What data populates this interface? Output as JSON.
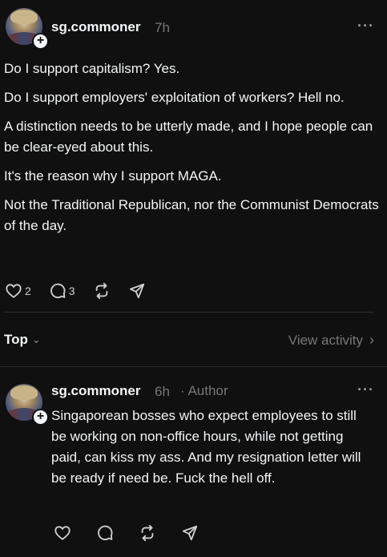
{
  "post": {
    "username": "sg.commoner",
    "time": "7h",
    "paragraphs": [
      "Do I support capitalism? Yes.",
      "Do I support employers' exploitation of workers? Hell no.",
      "A distinction needs to be utterly made, and I hope people can be clear-eyed about this.",
      "It's the reason why I support MAGA.",
      "Not the Traditional Republican, nor the Communist Democrats of the day."
    ],
    "like_count": "2",
    "reply_count": "3"
  },
  "sort": {
    "label": "Top",
    "view_activity": "View activity"
  },
  "reply": {
    "username": "sg.commoner",
    "time": "6h",
    "author_tag": "· Author",
    "text": "Singaporean bosses who expect employees to still be working on non-office hours, while not getting paid, can kiss my ass. And my resignation letter will be ready if need be. Fuck the hell off."
  },
  "icons": {
    "more": "more-icon",
    "like": "heart-icon",
    "reply": "comment-icon",
    "repost": "repost-icon",
    "share": "send-icon",
    "follow": "plus-icon"
  },
  "colors": {
    "background": "#101010",
    "text": "#f3f5f7",
    "secondary": "#777777"
  }
}
